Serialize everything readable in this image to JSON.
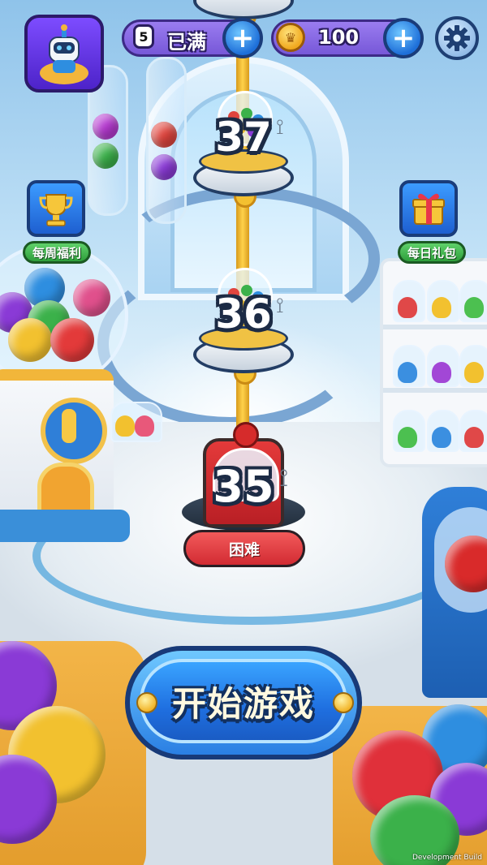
{
  "hud": {
    "lives_count": "5",
    "lives_status": "已满",
    "coins": "100",
    "avatar_icon": "robot-icon",
    "add_lives_icon": "plus-icon",
    "add_coins_icon": "plus-icon",
    "settings_icon": "gear-icon"
  },
  "side_buttons": {
    "weekly": {
      "label": "每周福利",
      "icon": "trophy-icon"
    },
    "daily": {
      "label": "每日礼包",
      "icon": "gift-icon"
    }
  },
  "levels": [
    {
      "number": "37"
    },
    {
      "number": "36"
    },
    {
      "number": "35",
      "difficulty": "困难",
      "current": true
    }
  ],
  "start_button": {
    "label": "开始游戏"
  },
  "footer": {
    "build_label": "Development Build"
  },
  "colors": {
    "accent_blue": "#1f6fe0",
    "hud_purple": "#7758d8",
    "badge_green": "#2e9e3b",
    "difficulty_red": "#d22b33",
    "rope_gold": "#f4c030"
  }
}
